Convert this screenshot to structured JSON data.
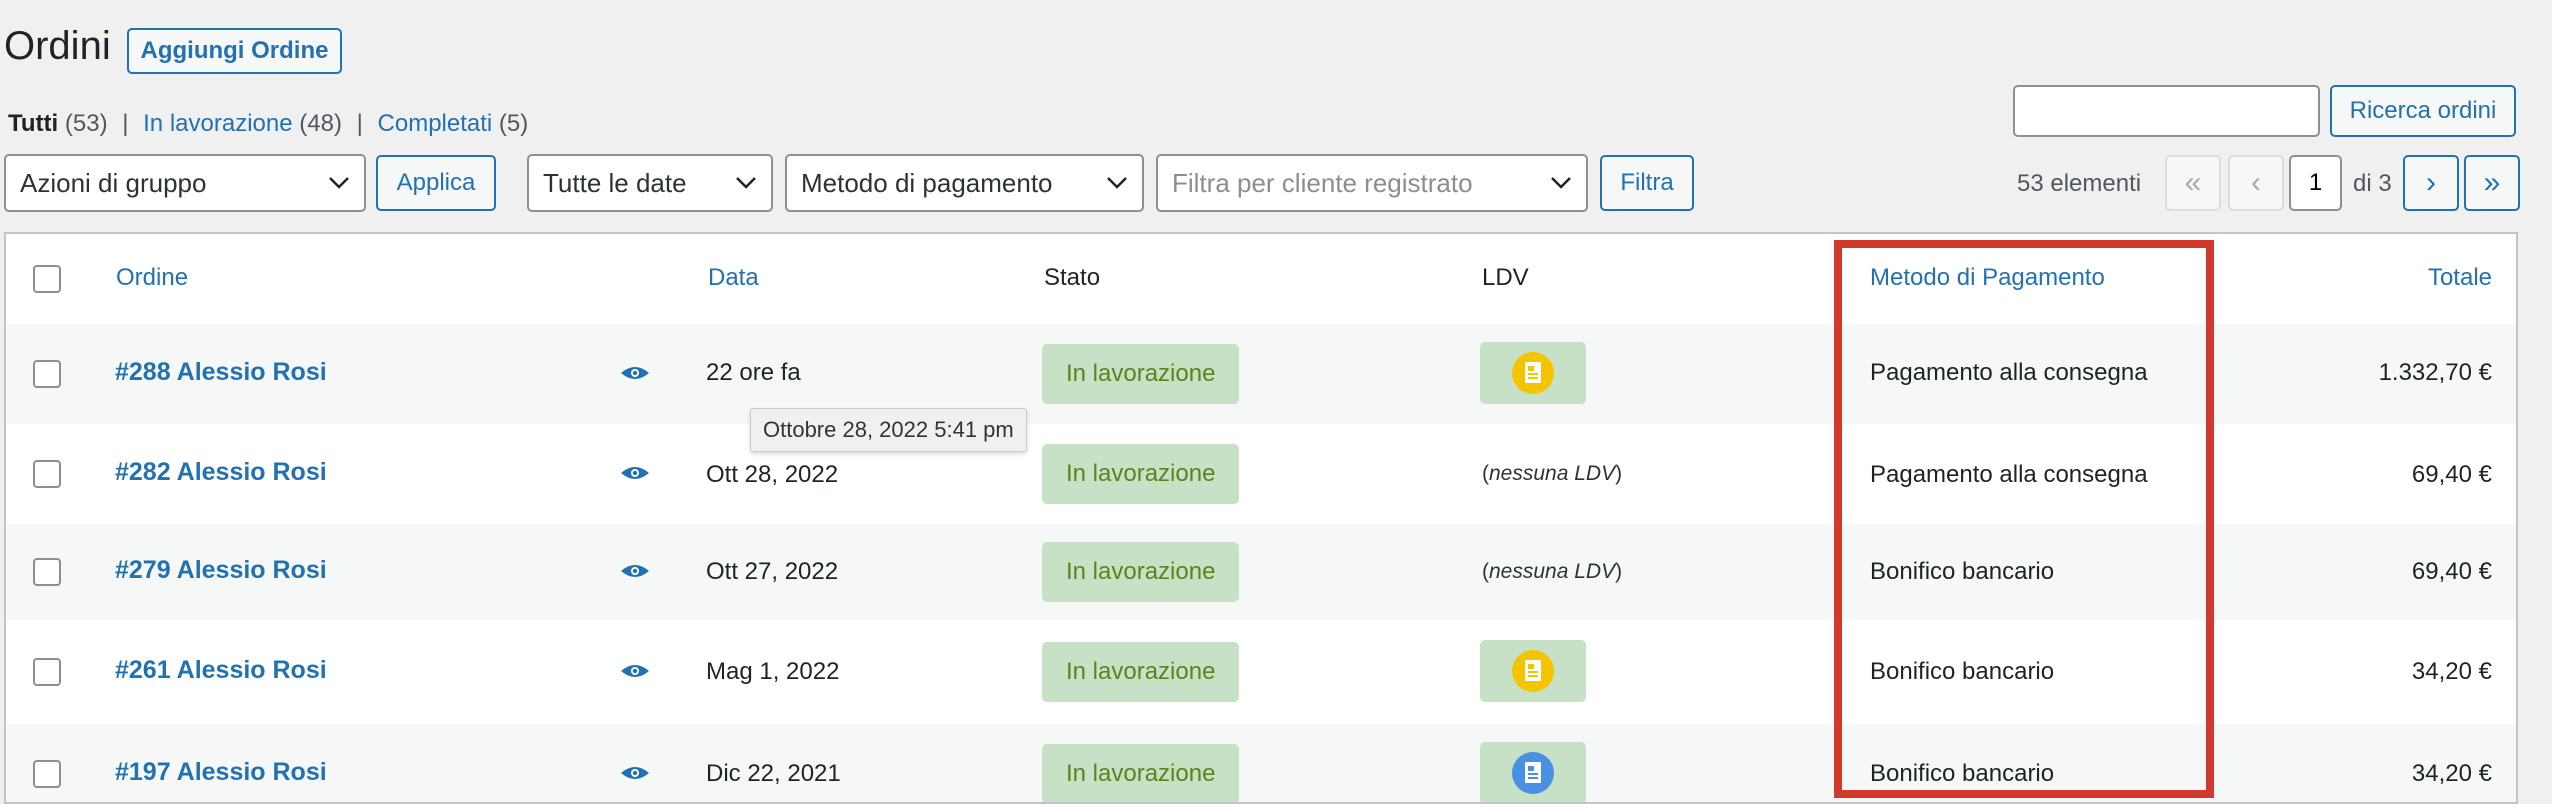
{
  "page": {
    "title": "Ordini",
    "add_button": "Aggiungi Ordine"
  },
  "status_filters": [
    {
      "label": "Tutti",
      "count": "(53)",
      "current": true
    },
    {
      "label": "In lavorazione",
      "count": "(48)",
      "current": false
    },
    {
      "label": "Completati",
      "count": "(5)",
      "current": false
    }
  ],
  "search": {
    "value": "",
    "placeholder": "",
    "button": "Ricerca ordini"
  },
  "filters": {
    "bulk_actions": "Azioni di gruppo",
    "apply": "Applica",
    "dates": "Tutte le date",
    "payment_method": "Metodo di pagamento",
    "customer_placeholder": "Filtra per cliente registrato",
    "filter_button": "Filtra"
  },
  "pagination": {
    "count": "53 elementi",
    "first": "«",
    "prev": "‹",
    "current": "1",
    "of": "di 3",
    "next": "›",
    "last": "»"
  },
  "columns": {
    "order": "Ordine",
    "date": "Data",
    "status": "Stato",
    "ldv": "LDV",
    "payment": "Metodo di Pagamento",
    "total": "Totale"
  },
  "rows": [
    {
      "order": "#288 Alessio Rosi",
      "date": "22 ore fa",
      "status": "In lavorazione",
      "ldv": {
        "type": "icon",
        "icon": "document-icon",
        "color": "#f5c400"
      },
      "payment": "Pagamento alla consegna",
      "total": "1.332,70 €"
    },
    {
      "order": "#282 Alessio Rosi",
      "date": "Ott 28, 2022",
      "status": "In lavorazione",
      "ldv": {
        "type": "text",
        "prefix": "(",
        "text": "nessuna LDV",
        "suffix": ")"
      },
      "payment": "Pagamento alla consegna",
      "total": "69,40 €"
    },
    {
      "order": "#279 Alessio Rosi",
      "date": "Ott 27, 2022",
      "status": "In lavorazione",
      "ldv": {
        "type": "text",
        "prefix": "(",
        "text": "nessuna LDV",
        "suffix": ")"
      },
      "payment": "Bonifico bancario",
      "total": "69,40 €"
    },
    {
      "order": "#261 Alessio Rosi",
      "date": "Mag 1, 2022",
      "status": "In lavorazione",
      "ldv": {
        "type": "icon",
        "icon": "document-icon",
        "color": "#f5c400"
      },
      "payment": "Bonifico bancario",
      "total": "34,20 €"
    },
    {
      "order": "#197 Alessio Rosi",
      "date": "Dic 22, 2021",
      "status": "In lavorazione",
      "ldv": {
        "type": "icon",
        "icon": "document-icon",
        "color": "#4a90e2"
      },
      "payment": "Bonifico bancario",
      "total": "34,20 €"
    }
  ],
  "tooltip": "Ottobre 28, 2022 5:41 pm",
  "colors": {
    "accent": "#2271b1",
    "status_bg": "#c6e1c6",
    "status_text": "#5b841b",
    "highlight": "#d0392b"
  }
}
